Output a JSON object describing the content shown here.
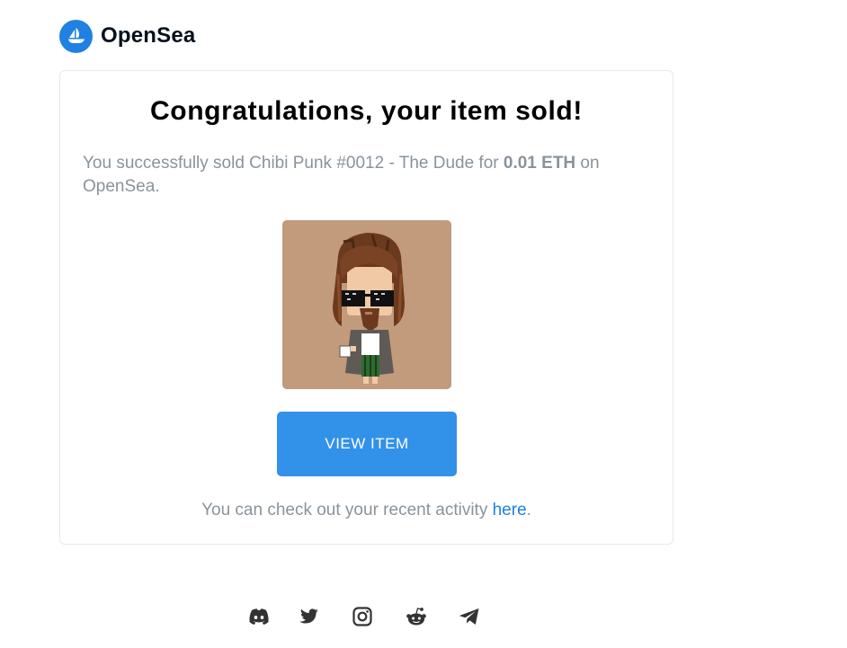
{
  "header": {
    "logo_text": "OpenSea",
    "brand_color": "#2081e2"
  },
  "card": {
    "title": "Congratulations, your item sold!",
    "message": {
      "prefix": "You successfully sold Chibi Punk #0012 - The Dude for ",
      "price": "0.01 ETH",
      "suffix": " on OpenSea."
    },
    "nft_image_icon": "chibi-punk-dude-image",
    "view_button_label": "VIEW ITEM",
    "button_color": "#3291e9",
    "activity": {
      "prefix": "You can check out your recent activity ",
      "link_text": "here",
      "suffix": "."
    }
  },
  "footer": {
    "social_icons": [
      "discord-icon",
      "twitter-icon",
      "instagram-icon",
      "reddit-icon",
      "telegram-icon"
    ]
  }
}
